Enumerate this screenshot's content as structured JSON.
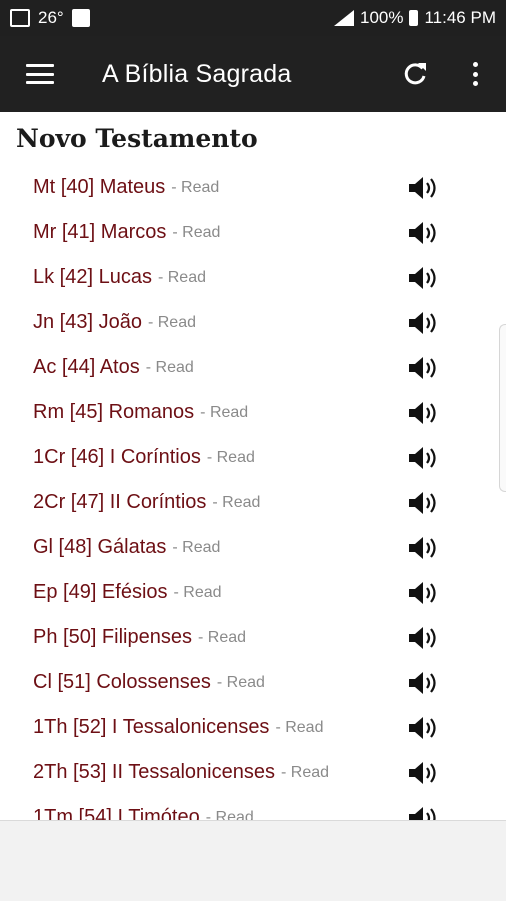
{
  "status_bar": {
    "temperature": "26°",
    "battery": "100%",
    "time": "11:46 PM"
  },
  "toolbar": {
    "title": "A Bíblia Sagrada"
  },
  "section": {
    "title": "Novo Testamento"
  },
  "read_label": "- Read",
  "books": [
    "Mt [40] Mateus",
    "Mr [41] Marcos",
    "Lk [42] Lucas",
    "Jn [43] João",
    "Ac [44] Atos",
    "Rm [45] Romanos",
    "1Cr [46] I Coríntios",
    "2Cr [47] II Coríntios",
    "Gl [48] Gálatas",
    "Ep [49] Efésios",
    "Ph [50] Filipenses",
    "Cl [51] Colossenses",
    "1Th [52] I Tessalonicenses",
    "2Th [53] II Tessalonicenses",
    "1Tm [54] I Timóteo"
  ],
  "colors": {
    "toolbar": "#212121",
    "book_text": "#6d0f14",
    "read_text": "#8a8a8a"
  }
}
